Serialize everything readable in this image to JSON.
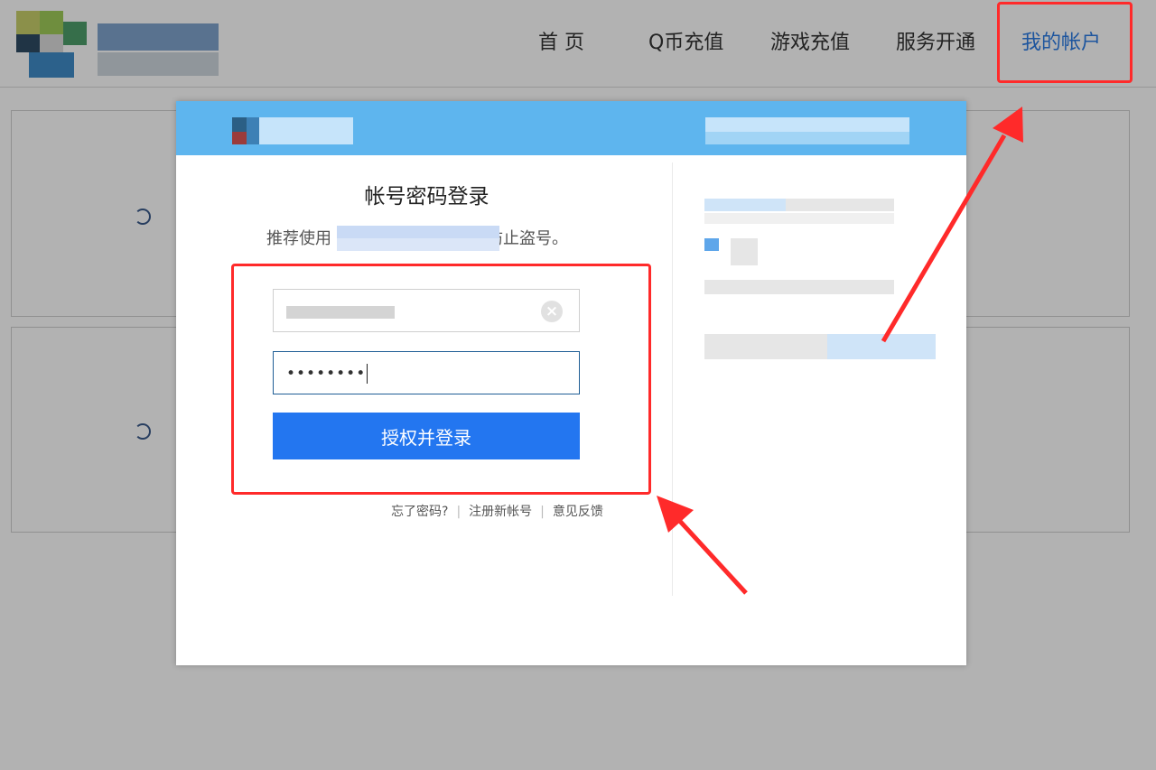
{
  "nav": {
    "items": [
      {
        "label": "首 页"
      },
      {
        "label": "Q币充值"
      },
      {
        "label": "游戏充值"
      },
      {
        "label": "服务开通"
      },
      {
        "label": "我的帐户"
      }
    ],
    "active_index": 4
  },
  "login": {
    "title": "帐号密码登录",
    "subtitle_prefix": "推荐使用",
    "subtitle_suffix": "防止盗号。",
    "password_value": "••••••••",
    "submit_label": "授权并登录",
    "links": {
      "forgot": "忘了密码?",
      "register": "注册新帐号",
      "feedback": "意见反馈"
    }
  },
  "colors": {
    "accent": "#2376f0",
    "header": "#5eb5ee",
    "annotation": "#ff2a2a"
  }
}
